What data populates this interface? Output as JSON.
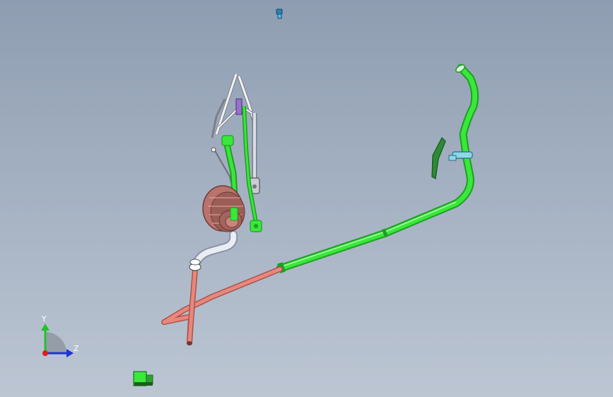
{
  "viewport": {
    "background_top": "#8e9db1",
    "background_bottom": "#bcc6d3"
  },
  "colors": {
    "green_pipe": "#39e83a",
    "green_pipe_dark": "#1f9e23",
    "salmon_pipe": "#e8877c",
    "salmon_pipe_dark": "#a9554c",
    "silver_pipe": "#e9edf4",
    "silver_pipe_dark": "#8a93a3",
    "clutch_body": "#b9736c",
    "clutch_dark": "#6d3a36",
    "bracket": "#2e8a35",
    "clip": "#8fd7ea",
    "frame_light": "#f2f2f6",
    "frame_dark": "#7c7f88",
    "purple_part": "#9a6fd0"
  },
  "triad": {
    "y_label": "Y",
    "z_label": "Z",
    "y_color": "#22c22c",
    "z_color": "#1f33d9",
    "x_color": "#e01b1b"
  },
  "icons": {
    "view_orientation": "view-orientation-icon",
    "model_thumbnail": "model-thumbnail-icon"
  }
}
